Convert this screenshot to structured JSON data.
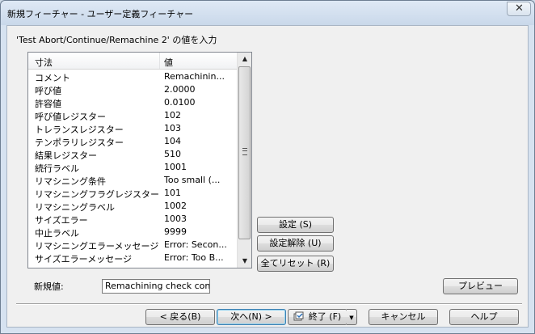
{
  "window": {
    "title": "新規フィーチャー - ユーザー定義フィーチャー",
    "close_glyph": "✕"
  },
  "prompt": "'Test Abort/Continue/Remachine 2' の値を入力",
  "list": {
    "columns": [
      "寸法",
      "値"
    ],
    "rows": [
      {
        "name": "コメント",
        "value": "Remachinin..."
      },
      {
        "name": "呼び値",
        "value": "2.0000"
      },
      {
        "name": "許容値",
        "value": "0.0100"
      },
      {
        "name": "呼び値レジスター",
        "value": "102"
      },
      {
        "name": "トレランスレジスター",
        "value": "103"
      },
      {
        "name": "テンポラリレジスター",
        "value": "104"
      },
      {
        "name": "結果レジスター",
        "value": "510"
      },
      {
        "name": "続行ラベル",
        "value": "1001"
      },
      {
        "name": "リマシニング条件",
        "value": "Too small (..."
      },
      {
        "name": "リマシニングフラグレジスター",
        "value": "101"
      },
      {
        "name": "リマシニングラベル",
        "value": "1002"
      },
      {
        "name": "サイズエラー",
        "value": "1003"
      },
      {
        "name": "中止ラベル",
        "value": "9999"
      },
      {
        "name": "リマシニングエラーメッセージ",
        "value": "Error: Secon..."
      },
      {
        "name": "サイズエラーメッセージ",
        "value": "Error: Too B..."
      }
    ],
    "scroll_up_glyph": "▲",
    "scroll_down_glyph": "▼"
  },
  "side_buttons": {
    "set": "設定 (S)",
    "unset": "設定解除 (U)",
    "reset_all": "全てリセット (R)"
  },
  "new_value": {
    "label": "新規値:",
    "value": "Remachining check cond"
  },
  "preview_button": "プレビュー",
  "footer": {
    "back": "< 戻る(B)",
    "next": "次へ(N) >",
    "finish": "終了 (F)",
    "finish_arrow": "▼",
    "cancel": "キャンセル",
    "help": "ヘルプ"
  },
  "icons": {
    "finish": "finish-icon"
  }
}
